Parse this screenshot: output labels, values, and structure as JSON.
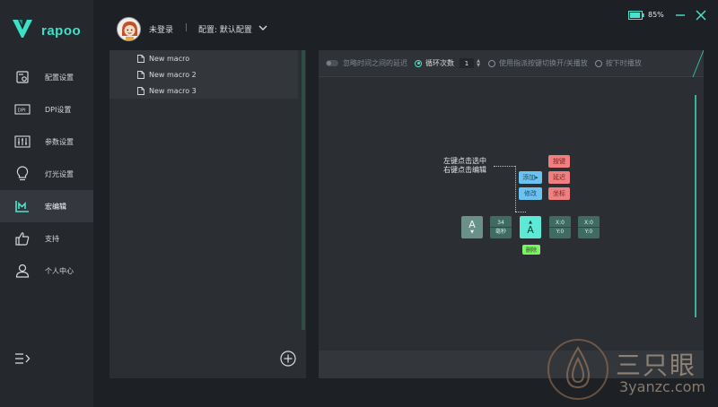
{
  "brand": {
    "name": "rapoo",
    "accent": "#3ee0c7"
  },
  "sidebar": {
    "items": [
      {
        "label": "配置设置",
        "icon": "config-icon"
      },
      {
        "label": "DPI设置",
        "icon": "dpi-icon"
      },
      {
        "label": "参数设置",
        "icon": "sliders-icon"
      },
      {
        "label": "灯光设置",
        "icon": "lightbulb-icon"
      },
      {
        "label": "宏编辑",
        "icon": "macro-icon",
        "active": true
      },
      {
        "label": "支持",
        "icon": "thumbs-up-icon"
      },
      {
        "label": "个人中心",
        "icon": "user-icon"
      }
    ],
    "collapse_icon": "collapse-menu-icon"
  },
  "header": {
    "login": "未登录",
    "separator": "|",
    "config": "配置: 默认配置",
    "battery": "85%"
  },
  "macros": {
    "items": [
      "New macro",
      "New macro 2",
      "New macro 3"
    ]
  },
  "toolbar": {
    "ignore_delay": "忽略时间之间的延迟",
    "loop_count_label": "循环次数",
    "loop_count_value": "1",
    "toggle_play": "使用指派按键切换开/关播放",
    "hold_play": "按下时播放"
  },
  "diagram": {
    "hint_line1": "左键点击选中",
    "hint_line2": "右键点击编辑",
    "tag_key": "按键",
    "tag_delay": "延迟",
    "tag_coord": "坐标",
    "tag_add": "添加▸",
    "tag_edit": "修改",
    "key1_label": "A",
    "key1_arrow": "▼",
    "delay_value": "34",
    "delay_unit": "毫秒",
    "key2_arrow": "▲",
    "key2_label": "A",
    "coord1_x": "X:0",
    "coord1_y": "Y:0",
    "coord2_x": "X:0",
    "coord2_y": "Y:0",
    "delete": "删除"
  },
  "watermark": {
    "title": "三只眼",
    "url": "3yanzc.com"
  }
}
